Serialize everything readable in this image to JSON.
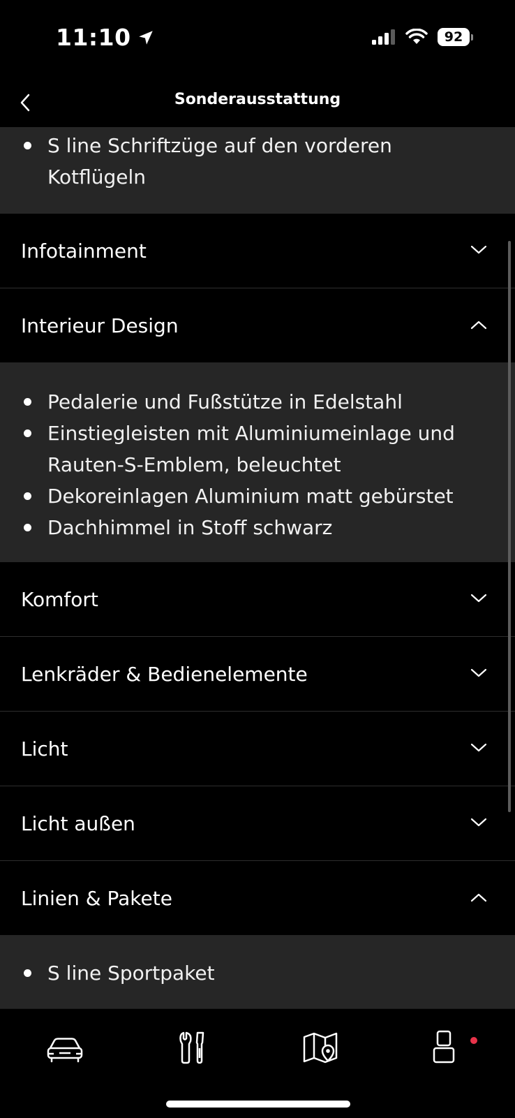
{
  "status_bar": {
    "time": "11:10",
    "battery": "92"
  },
  "nav": {
    "title": "Sonderausstattung"
  },
  "top_panel": {
    "items": [
      "S line Schriftzüge auf den vorderen Kotflügeln"
    ]
  },
  "sections": [
    {
      "label": "Infotainment",
      "expanded": false
    },
    {
      "label": "Interieur Design",
      "expanded": true,
      "items": [
        "Pedalerie und Fußstütze in Edelstahl",
        "Einstiegleisten mit Aluminiumeinlage und Rauten-S-Emblem, beleuchtet",
        "Dekoreinlagen Aluminium matt gebürstet",
        "Dachhimmel in Stoff schwarz"
      ]
    },
    {
      "label": "Komfort",
      "expanded": false
    },
    {
      "label": "Lenkräder & Bedienelemente",
      "expanded": false
    },
    {
      "label": "Licht",
      "expanded": false
    },
    {
      "label": "Licht außen",
      "expanded": false
    },
    {
      "label": "Linien & Pakete",
      "expanded": true,
      "items": [
        "S line Sportpaket"
      ]
    }
  ],
  "tab_bar": {
    "tabs": [
      {
        "name": "car-icon"
      },
      {
        "name": "tools-icon"
      },
      {
        "name": "map-icon"
      },
      {
        "name": "profile-icon"
      }
    ],
    "notification_color": "#e8334a"
  }
}
